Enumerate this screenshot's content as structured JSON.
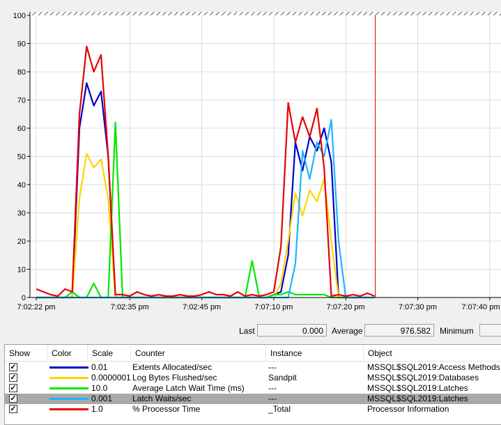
{
  "chart_data": {
    "type": "line",
    "ylim": [
      0,
      100
    ],
    "yticks": [
      "100",
      "90",
      "80",
      "70",
      "60",
      "50",
      "40",
      "30",
      "20",
      "10",
      "0"
    ],
    "xtick_labels": [
      "7:02:22 pm",
      "7:02:35 pm",
      "7:02:45 pm",
      "7:07:10 pm",
      "7:07:20 pm",
      "7:07:30 pm",
      "7:07:40 pm"
    ],
    "xtick_samples": [
      0,
      13,
      23,
      33,
      43,
      53,
      63
    ],
    "x_samples_visible": 68,
    "current_sample": 47,
    "series": [
      {
        "name": "Extents Allocated/sec",
        "color": "#0000c8",
        "values": [
          0,
          0,
          0,
          0,
          0,
          0,
          60,
          76,
          68,
          73,
          50,
          0,
          0,
          0,
          0,
          0,
          0,
          0,
          0,
          0,
          0,
          0,
          0,
          0,
          0,
          0,
          0,
          0,
          0,
          0,
          0,
          0,
          0,
          1,
          2,
          15,
          55,
          45,
          57,
          52,
          60,
          48,
          0,
          0,
          0,
          0,
          0,
          0
        ]
      },
      {
        "name": "Log Bytes Flushed/sec",
        "color": "#ffd400",
        "values": [
          0,
          0,
          0,
          0,
          0,
          0,
          35,
          51,
          46,
          49,
          35,
          0,
          0,
          0,
          0,
          0,
          0,
          0,
          0,
          0,
          0,
          0,
          0,
          0,
          0,
          0,
          0,
          0,
          0,
          0,
          0,
          0,
          0,
          0,
          5,
          20,
          37,
          29,
          38,
          34,
          42,
          20,
          0,
          0,
          0,
          0,
          0,
          0
        ]
      },
      {
        "name": "Average Latch Wait Time (ms)",
        "color": "#00e600",
        "values": [
          0,
          0,
          0,
          0,
          0,
          2,
          0,
          0,
          5,
          0,
          0,
          62,
          0,
          0,
          0,
          0,
          0,
          0,
          0,
          0,
          0,
          0,
          0,
          0,
          0,
          0,
          0,
          0,
          0,
          0,
          13,
          0,
          0,
          1,
          1,
          2,
          1,
          1,
          1,
          1,
          1,
          0,
          0,
          0,
          0,
          0,
          0,
          0
        ]
      },
      {
        "name": "Latch Waits/sec",
        "color": "#1eb4ff",
        "values": [
          0,
          0,
          0,
          0,
          0,
          0,
          0,
          0,
          0,
          0,
          0,
          0,
          0,
          0,
          0,
          0,
          0,
          0,
          0,
          0,
          0,
          0,
          0,
          0,
          0,
          0,
          0,
          0,
          0,
          0,
          0,
          0,
          0,
          0,
          0,
          0,
          12,
          52,
          42,
          55,
          50,
          63,
          20,
          0,
          0,
          0,
          0,
          0
        ]
      },
      {
        "name": "% Processor Time",
        "color": "#e60000",
        "values": [
          3,
          2,
          1,
          0.5,
          3,
          2,
          65,
          89,
          80,
          86,
          50,
          1,
          1,
          0.5,
          2,
          1,
          0.5,
          1,
          0.5,
          0.5,
          1,
          0.5,
          0.5,
          1,
          2,
          1,
          1,
          0.5,
          2,
          0.5,
          1,
          0.5,
          1,
          2,
          18,
          69,
          55,
          64,
          57,
          67,
          46,
          0.5,
          1,
          0.5,
          1,
          0.5,
          1.5,
          0.5
        ]
      }
    ]
  },
  "stats": {
    "last_label": "Last",
    "last_value": "0.000",
    "average_label": "Average",
    "average_value": "976.582",
    "minimum_label": "Minimum"
  },
  "legend": {
    "columns": [
      "Show",
      "Color",
      "Scale",
      "Counter",
      "Instance",
      "Object"
    ],
    "rows": [
      {
        "show": true,
        "color": "#0000c8",
        "scale": "0.01",
        "counter": "Extents Allocated/sec",
        "instance": "---",
        "object": "MSSQL$SQL2019:Access Methods",
        "selected": false
      },
      {
        "show": true,
        "color": "#ffd400",
        "scale": "0.0000001",
        "counter": "Log Bytes Flushed/sec",
        "instance": "Sandpit",
        "object": "MSSQL$SQL2019:Databases",
        "selected": false
      },
      {
        "show": true,
        "color": "#00e600",
        "scale": "10.0",
        "counter": "Average Latch Wait Time (ms)",
        "instance": "---",
        "object": "MSSQL$SQL2019:Latches",
        "selected": false
      },
      {
        "show": true,
        "color": "#1eb4ff",
        "scale": "0.001",
        "counter": "Latch Waits/sec",
        "instance": "---",
        "object": "MSSQL$SQL2019:Latches",
        "selected": true
      },
      {
        "show": true,
        "color": "#e60000",
        "scale": "1.0",
        "counter": "% Processor Time",
        "instance": "_Total",
        "object": "Processor Information",
        "selected": false
      }
    ]
  }
}
